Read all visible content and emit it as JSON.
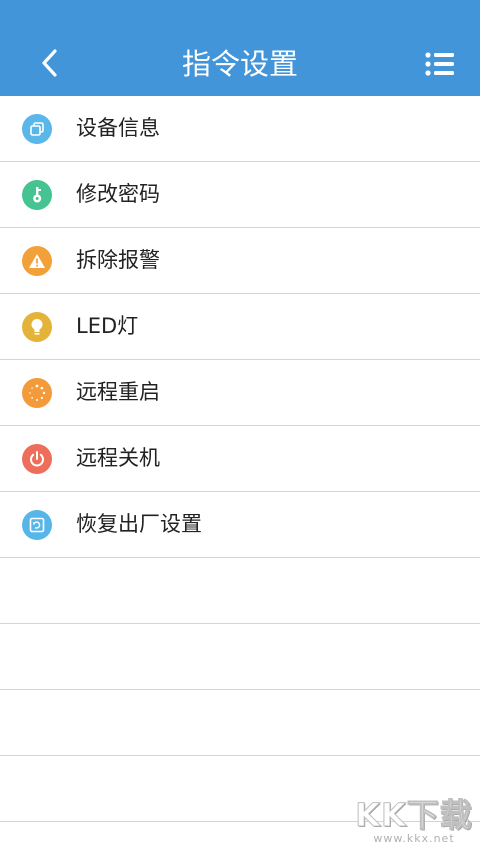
{
  "header": {
    "title": "指令设置",
    "back_icon": "chevron-left-icon",
    "menu_icon": "list-menu-icon",
    "background": "#4295d8"
  },
  "commands": [
    {
      "label": "设备信息",
      "icon": "device-info-icon",
      "color": "#5bb6ea"
    },
    {
      "label": "修改密码",
      "icon": "key-icon",
      "color": "#45c491"
    },
    {
      "label": "拆除报警",
      "icon": "warning-icon",
      "color": "#f2a03a"
    },
    {
      "label": "LED灯",
      "icon": "bulb-icon",
      "color": "#e3b33a"
    },
    {
      "label": "远程重启",
      "icon": "restart-icon",
      "color": "#f39a3b"
    },
    {
      "label": "远程关机",
      "icon": "power-icon",
      "color": "#ee6e5c"
    },
    {
      "label": "恢复出厂设置",
      "icon": "factory-reset-icon",
      "color": "#58b5e8"
    }
  ],
  "watermark": {
    "logo": "KK下载",
    "url": "www.kkx.net"
  }
}
